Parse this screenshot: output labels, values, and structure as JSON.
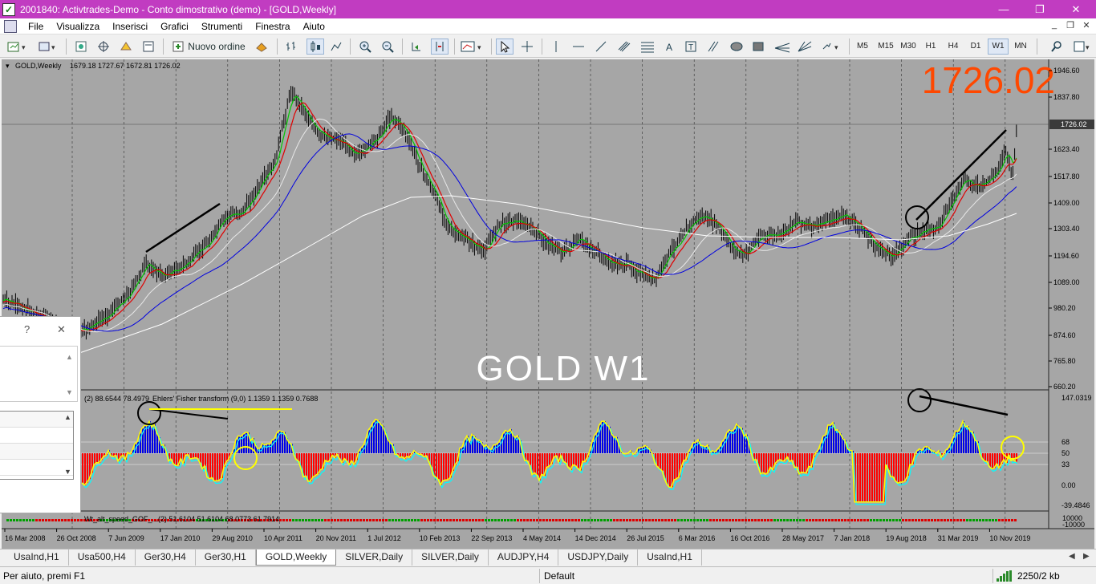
{
  "window": {
    "title": "2001840: Activtrades-Demo - Conto dimostrativo (demo) - [GOLD,Weekly]",
    "minimize": "—",
    "maximize": "❐",
    "close": "✕"
  },
  "menu": {
    "items": [
      "File",
      "Visualizza",
      "Inserisci",
      "Grafici",
      "Strumenti",
      "Finestra",
      "Aiuto"
    ],
    "mdi_minimize": "_",
    "mdi_restore": "❐",
    "mdi_close": "✕"
  },
  "toolbar": {
    "new_order_label": "Nuovo ordine",
    "timeframes": [
      "M5",
      "M15",
      "M30",
      "H1",
      "H4",
      "D1",
      "W1",
      "MN"
    ],
    "active_timeframe": "W1"
  },
  "chart": {
    "symbol_label": "GOLD,Weekly",
    "ohlc": "1679.18 1727.67 1672.81 1726.02",
    "big_price": "1726.02",
    "watermark": "GOLD  W1",
    "price_axis": [
      "1946.60",
      "1837.80",
      "1726.02",
      "1623.40",
      "1517.80",
      "1409.00",
      "1303.40",
      "1194.60",
      "1089.00",
      "980.20",
      "874.60",
      "765.80",
      "660.20"
    ],
    "current_price": "1726.02",
    "osc_label": "(2) 88.6544 78.4979",
    "osc_label2": "Ehlers' Fisher transform (9,0) 1.1359 1.1359 0.7688",
    "osc_axis": [
      "147.0319",
      "68",
      "50",
      "33",
      "0.00",
      "-39.4846"
    ],
    "bottom_label": "Wt_alt_speed_GOF_...(2) 51.6104 51.6104 68.0773 61.7914",
    "bottom_axis": [
      "10000",
      "-10000"
    ],
    "time_axis": [
      "16 Mar 2008",
      "26 Oct 2008",
      "7 Jun 2009",
      "17 Jan 2010",
      "29 Aug 2010",
      "10 Apr 2011",
      "20 Nov 2011",
      "1 Jul 2012",
      "10 Feb 2013",
      "22 Sep 2013",
      "4 May 2014",
      "14 Dec 2014",
      "26 Jul 2015",
      "6 Mar 2016",
      "16 Oct 2016",
      "28 May 2017",
      "7 Jan 2018",
      "19 Aug 2018",
      "31 Mar 2019",
      "10 Nov 2019"
    ],
    "colors": {
      "background": "#a6a6a6",
      "big_price": "#ff4800",
      "bull_hist": "#0000e6",
      "bear_hist": "#ff0000",
      "fisher_line": "#ffff00",
      "trigger_line": "#00ffff",
      "ma_fast": "#00c800",
      "ma_mid": "#e00000",
      "ma_slow": "#0000e0",
      "ma_long": "#ffffff"
    }
  },
  "dialog": {
    "help": "?",
    "close": "✕"
  },
  "tabs": [
    "UsaInd,H1",
    "Usa500,H4",
    "Ger30,H4",
    "Ger30,H1",
    "GOLD,Weekly",
    "SILVER,Daily",
    "SILVER,Daily",
    "AUDJPY,H4",
    "USDJPY,Daily",
    "UsaInd,H1"
  ],
  "active_tab": "GOLD,Weekly",
  "status": {
    "help_text": "Per aiuto, premi F1",
    "profile": "Default",
    "traffic": "2250/2 kb"
  }
}
